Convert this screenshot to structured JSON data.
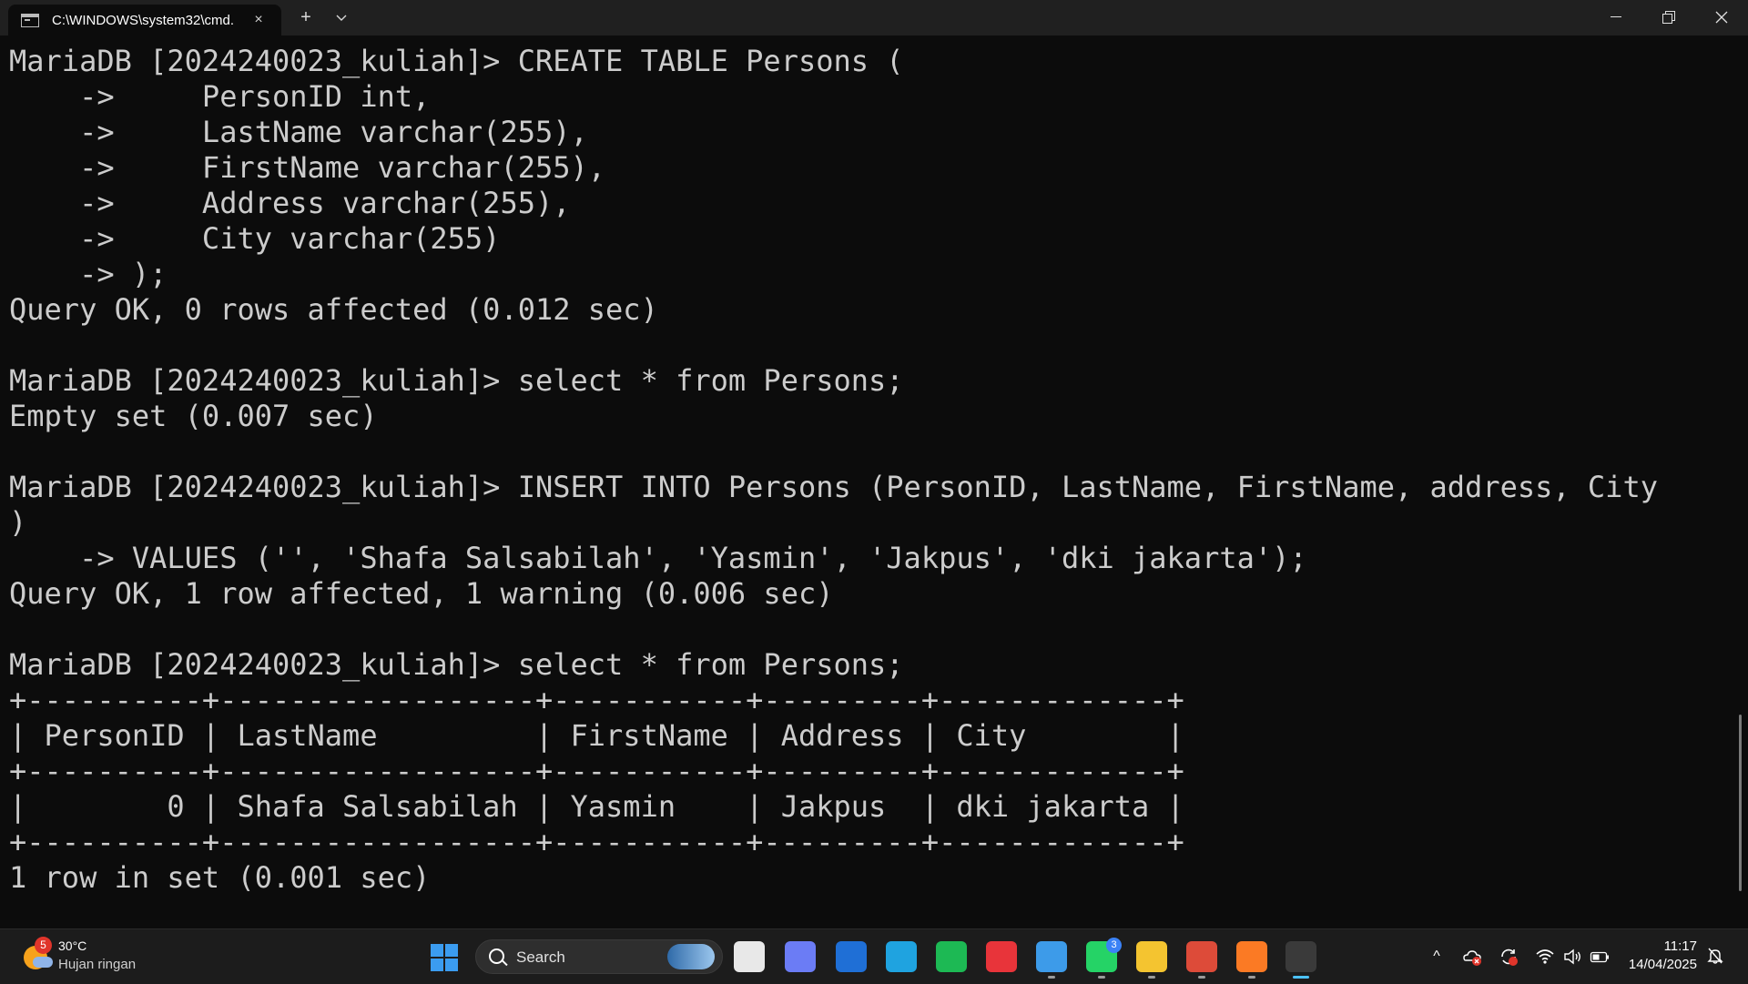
{
  "window": {
    "tab_title": "C:\\WINDOWS\\system32\\cmd.",
    "new_tab_symbol": "+",
    "dropdown_symbol": "⌄",
    "close_symbol": "×"
  },
  "terminal": {
    "lines": [
      "MariaDB [2024240023_kuliah]> CREATE TABLE Persons (",
      "    ->     PersonID int,",
      "    ->     LastName varchar(255),",
      "    ->     FirstName varchar(255),",
      "    ->     Address varchar(255),",
      "    ->     City varchar(255)",
      "    -> );",
      "Query OK, 0 rows affected (0.012 sec)",
      "",
      "MariaDB [2024240023_kuliah]> select * from Persons;",
      "Empty set (0.007 sec)",
      "",
      "MariaDB [2024240023_kuliah]> INSERT INTO Persons (PersonID, LastName, FirstName, address, City",
      ")",
      "    -> VALUES ('', 'Shafa Salsabilah', 'Yasmin', 'Jakpus', 'dki jakarta');",
      "Query OK, 1 row affected, 1 warning (0.006 sec)",
      "",
      "MariaDB [2024240023_kuliah]> select * from Persons;",
      "+----------+------------------+-----------+---------+-------------+",
      "| PersonID | LastName         | FirstName | Address | City        |",
      "+----------+------------------+-----------+---------+-------------+",
      "|        0 | Shafa Salsabilah | Yasmin    | Jakpus  | dki jakarta |",
      "+----------+------------------+-----------+---------+-------------+",
      "1 row in set (0.001 sec)"
    ]
  },
  "taskbar": {
    "weather": {
      "badge": "5",
      "temp": "30°C",
      "desc": "Hujan ringan"
    },
    "search_placeholder": "Search",
    "apps": [
      {
        "name": "task-view",
        "color": "#e8e8e8",
        "active": false
      },
      {
        "name": "copilot",
        "color": "#6b7cf5",
        "active": false
      },
      {
        "name": "microsoft-store",
        "color": "#1f6fd6",
        "active": false
      },
      {
        "name": "edge",
        "color": "#1fa3e0",
        "active": false
      },
      {
        "name": "spotify",
        "color": "#1db954",
        "active": false
      },
      {
        "name": "wps-office",
        "color": "#e8343a",
        "active": false
      },
      {
        "name": "notepad",
        "color": "#3d9be9",
        "active": true
      },
      {
        "name": "whatsapp",
        "color": "#25d366",
        "active": true,
        "badge": "3"
      },
      {
        "name": "file-explorer",
        "color": "#f4c430",
        "active": true
      },
      {
        "name": "chrome",
        "color": "#dd4b39",
        "active": true
      },
      {
        "name": "xampp",
        "color": "#fb7a24",
        "active": true
      },
      {
        "name": "terminal",
        "color": "#3a3a3a",
        "active": true
      }
    ],
    "tray": {
      "chevron": "^"
    },
    "clock": {
      "time": "11:17",
      "date": "14/04/2025"
    }
  }
}
